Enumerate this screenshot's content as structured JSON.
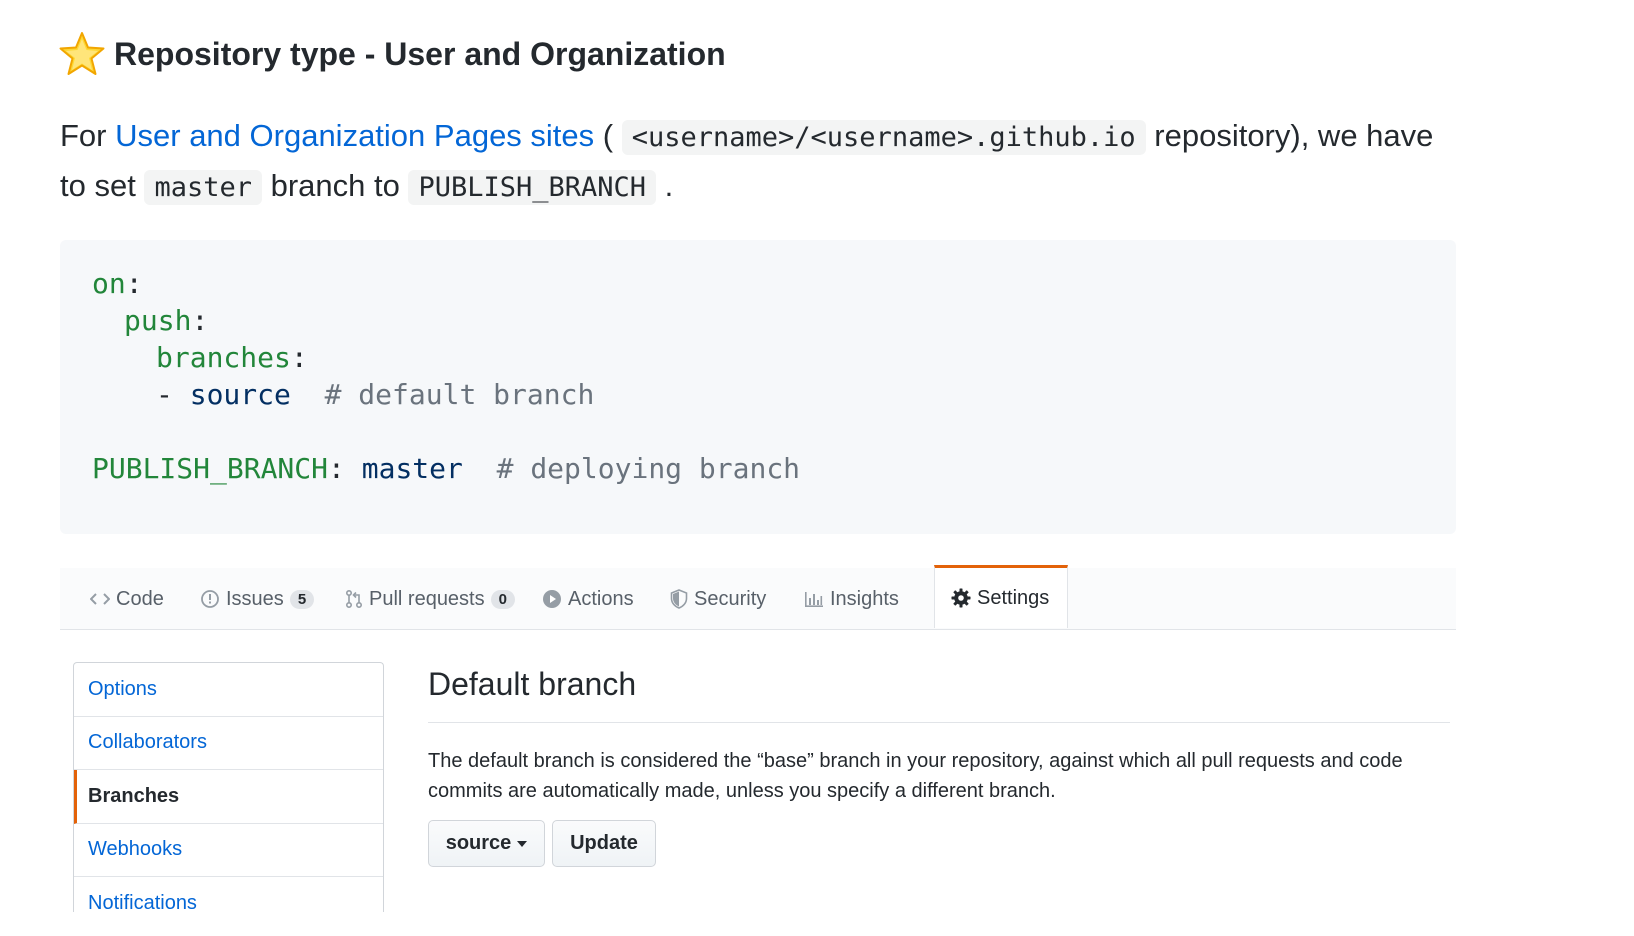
{
  "heading": {
    "title": "Repository type - User and Organization"
  },
  "intro": {
    "prefix": "For ",
    "link": "User and Organization Pages sites",
    "mid1": " ( ",
    "repo_code": "<username>/<username>.github.io",
    "mid2": " repository), we have to set ",
    "branch_code": "master",
    "mid3": " branch to ",
    "publish_code": "PUBLISH_BRANCH",
    "suffix": " ."
  },
  "code": {
    "on": "on",
    "push": "push",
    "branches": "branches",
    "dash": "- ",
    "source": "source",
    "comment1": "# default branch",
    "publish_key": "PUBLISH_BRANCH",
    "publish_value": "master",
    "comment2": "# deploying branch",
    "colon": ":"
  },
  "tabs": {
    "code": "Code",
    "issues": "Issues",
    "issues_count": "5",
    "pulls": "Pull requests",
    "pulls_count": "0",
    "actions": "Actions",
    "security": "Security",
    "insights": "Insights",
    "settings": "Settings"
  },
  "menu": {
    "options": "Options",
    "collaborators": "Collaborators",
    "branches": "Branches",
    "webhooks": "Webhooks",
    "notifications": "Notifications"
  },
  "panel": {
    "title": "Default branch",
    "description": "The default branch is considered the “base” branch in your repository, against which all pull requests and code commits are automatically made, unless you specify a different branch.",
    "branch_select": "source",
    "update_button": "Update"
  },
  "colors": {
    "link": "#0366d6",
    "accent": "#e36209",
    "code_key": "#22863a",
    "code_value": "#032f62",
    "code_comment": "#6a737d"
  }
}
